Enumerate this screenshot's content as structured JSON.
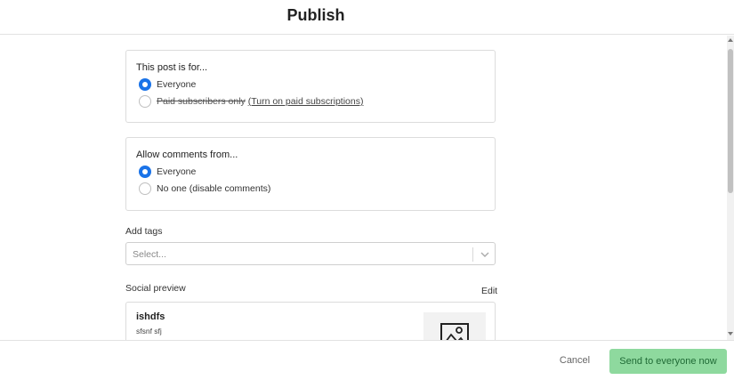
{
  "header": {
    "title": "Publish"
  },
  "audience": {
    "title": "This post is for...",
    "options": [
      {
        "label": "Everyone",
        "checked": true
      },
      {
        "label": "Paid subscribers only",
        "link": "(Turn on paid subscriptions)",
        "checked": false
      }
    ]
  },
  "comments": {
    "title": "Allow comments from...",
    "options": [
      {
        "label": "Everyone",
        "checked": true
      },
      {
        "label": "No one (disable comments)",
        "checked": false
      }
    ]
  },
  "tags": {
    "label": "Add tags",
    "placeholder": "Select..."
  },
  "social_preview": {
    "label": "Social preview",
    "edit_label": "Edit",
    "title": "ishdfs",
    "subtitle": "sfsnf sfj"
  },
  "footer": {
    "cancel_label": "Cancel",
    "send_label": "Send to everyone now"
  },
  "colors": {
    "accent": "#1a73e8",
    "send_button": "#8ed99e",
    "send_text": "#1f6a35"
  }
}
